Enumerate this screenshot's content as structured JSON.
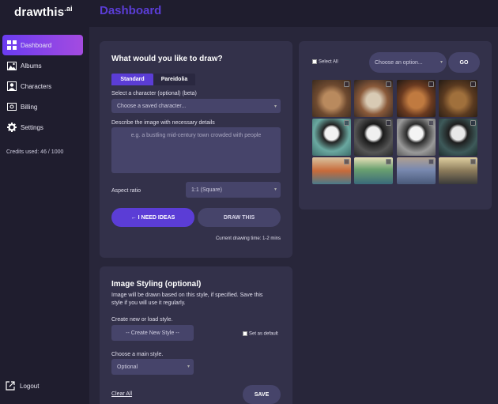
{
  "app": {
    "logo_main": "drawthis",
    "logo_suffix": ".ai",
    "page_title": "Dashboard"
  },
  "sidebar": {
    "items": [
      {
        "label": "Dashboard",
        "icon": "dashboard-icon"
      },
      {
        "label": "Albums",
        "icon": "image-icon"
      },
      {
        "label": "Characters",
        "icon": "user-icon"
      },
      {
        "label": "Billing",
        "icon": "billing-icon"
      },
      {
        "label": "Settings",
        "icon": "gear-icon"
      }
    ],
    "credits": "Credits used: 46 / 1000",
    "logout": "Logout"
  },
  "draw": {
    "title": "What would you like to draw?",
    "tabs": [
      "Standard",
      "Pareidolia"
    ],
    "character_label": "Select a character (optional) (beta)",
    "character_select": "Choose a saved character...",
    "describe_label": "Describe the image with necessary details",
    "describe_placeholder": "e.g. a bustling mid-century town crowded with people",
    "aspect_label": "Aspect ratio",
    "aspect_value": "1:1 (Square)",
    "ideas_button": "← I NEED IDEAS",
    "draw_button": "DRAW THIS",
    "drawing_time": "Current drawing time: 1-2 mins"
  },
  "styling": {
    "title": "Image Styling (optional)",
    "description_lines": [
      "Image will be drawn based on this style, if specified. Save this",
      "style if you will use it regularly."
    ],
    "create_label": "Create new or load style.",
    "create_select": "-- Create New Style --",
    "default_label": "Set as default",
    "main_style_label": "Choose a main style.",
    "main_style_select": "Optional",
    "clear_all": "Clear All",
    "save_button": "SAVE"
  },
  "gallery": {
    "select_all": "Select All",
    "action_select": "Choose an option...",
    "go_button": "GO"
  },
  "colors": {
    "accent": "#5b3dd6",
    "sidebar_active_start": "#6a3cf0",
    "sidebar_active_end": "#a44be0"
  }
}
